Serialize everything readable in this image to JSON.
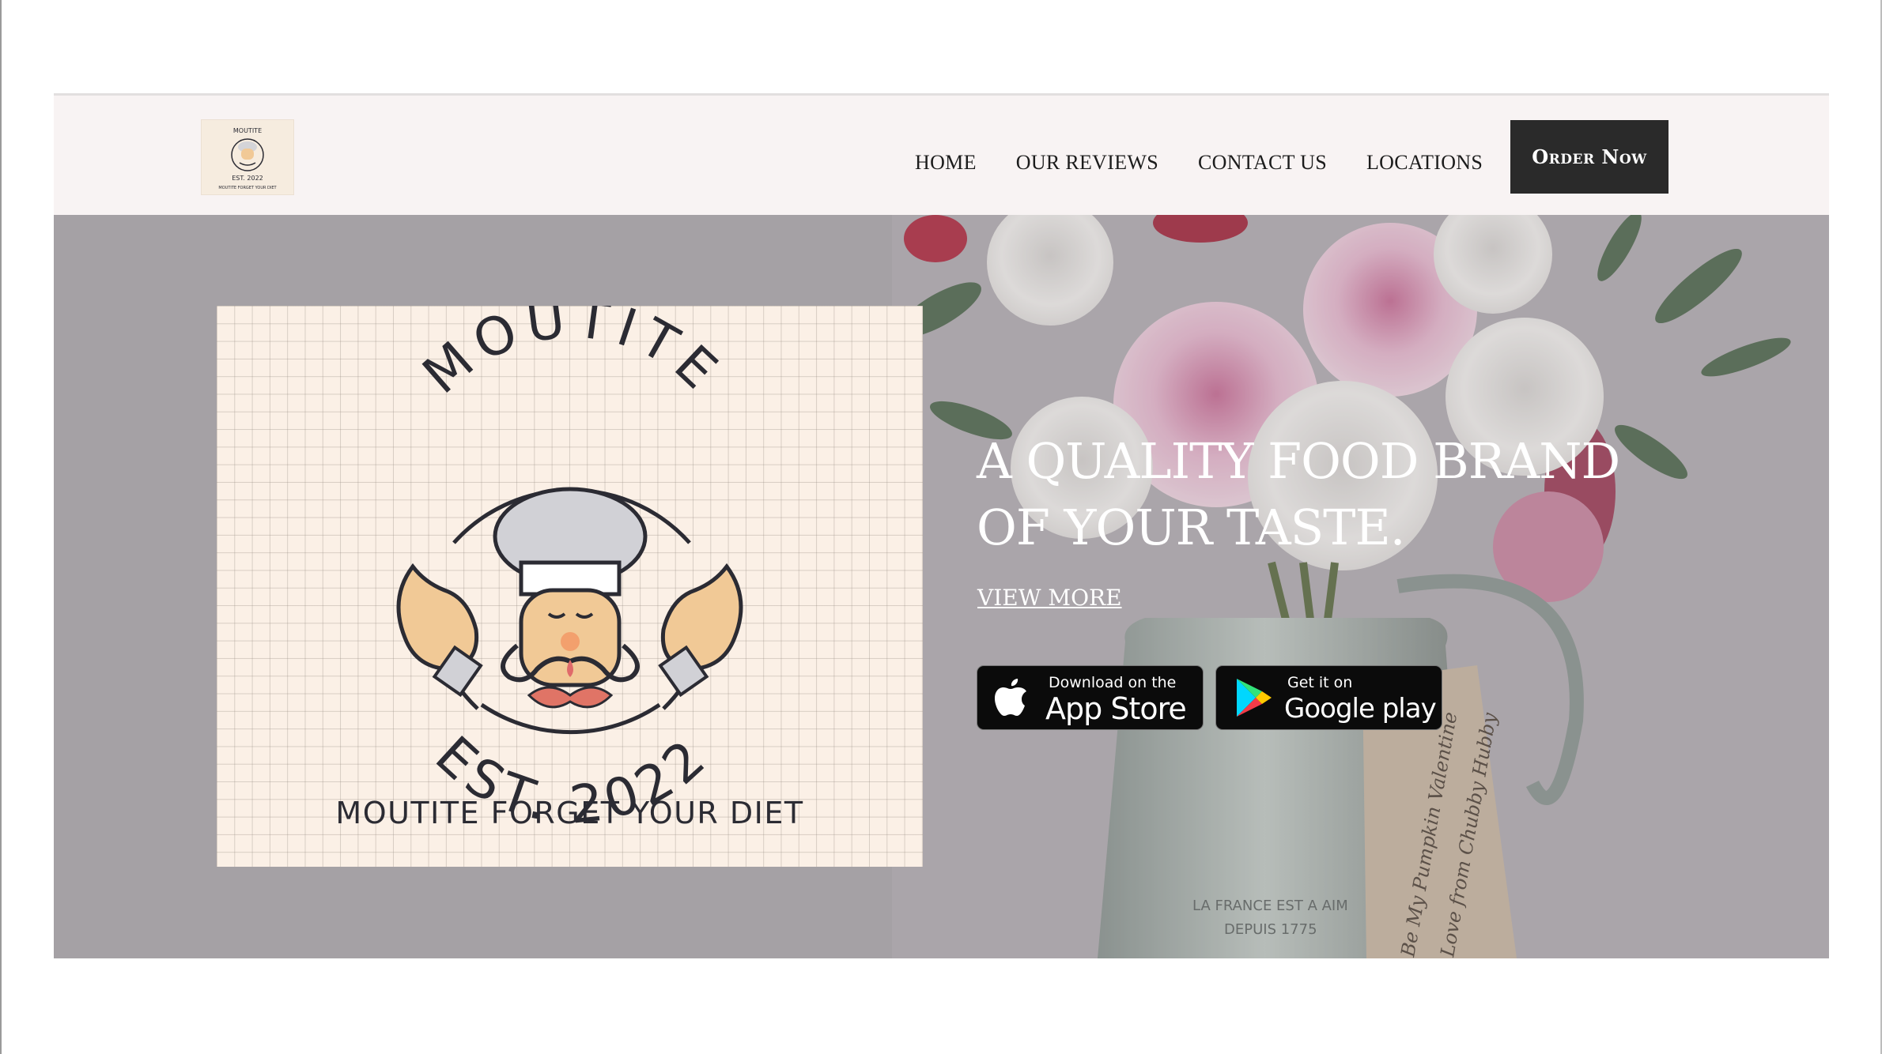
{
  "brand": {
    "logo_icon": "chef-logo-icon",
    "logo_text_top": "MOUTITE",
    "logo_text_est": "EST. 2022",
    "logo_tagline": "MOUTITE FORGET YOUR DIET"
  },
  "nav": {
    "items": [
      {
        "label": "HOME"
      },
      {
        "label": "OUR REVIEWS"
      },
      {
        "label": "CONTACT US"
      },
      {
        "label": "LOCATIONS"
      }
    ],
    "cta_label": "Order Now"
  },
  "hero": {
    "title_line1": "A QUALITY FOOD BRAND",
    "title_line2": "OF YOUR TASTE.",
    "view_more": "VIEW MORE",
    "background_image": "flower-bouquet-in-watering-can",
    "jug_text_line1": "LA FRANCE EST A AIM",
    "jug_text_line2": "DEPUIS 1775",
    "tag_text_line1": "Be My Pumpkin Valentine",
    "tag_text_line2": "Love from Chubby Hubby"
  },
  "stores": {
    "appstore_small": "Download on the",
    "appstore_big": "App Store",
    "appstore_icon": "apple-icon",
    "googleplay_small": "Get it on",
    "googleplay_big": "Google play",
    "googleplay_icon": "google-play-icon"
  },
  "colors": {
    "nav_bg": "#f8f3f3",
    "cta_bg": "#2a2a2a",
    "hero_bg": "#aba7ab",
    "logo_card_bg": "#fbf0e6",
    "ink": "#2b2b33"
  }
}
